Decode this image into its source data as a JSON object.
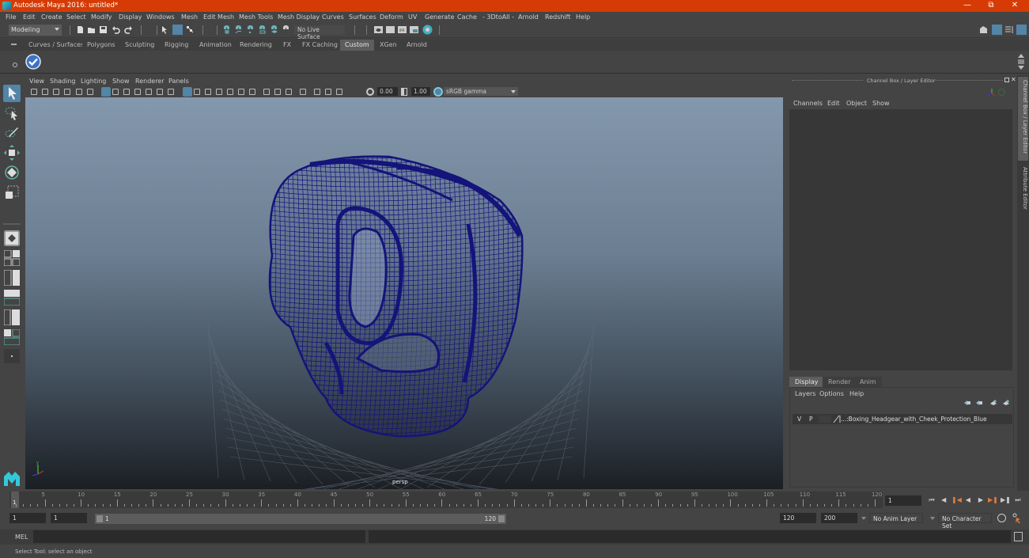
{
  "window": {
    "title": "Autodesk Maya 2016: untitled*",
    "controls": [
      "minimize",
      "restore",
      "close"
    ]
  },
  "menubar": {
    "items": [
      "File",
      "Edit",
      "Create",
      "Select",
      "Modify",
      "Display",
      "Windows",
      "Mesh",
      "Edit Mesh",
      "Mesh Tools",
      "Mesh Display",
      "Curves",
      "Surfaces",
      "Deform",
      "UV",
      "Generate",
      "Cache",
      "- 3DtoAll -",
      "Arnold",
      "Redshift",
      "Help"
    ]
  },
  "statusline": {
    "mode": "Modeling",
    "live_surface": "No Live Surface"
  },
  "shelf": {
    "tabs": [
      "Curves / Surfaces",
      "Polygons",
      "Sculpting",
      "Rigging",
      "Animation",
      "Rendering",
      "FX",
      "FX Caching",
      "Custom",
      "XGen",
      "Arnold"
    ],
    "active_tab": "Custom"
  },
  "viewport": {
    "menu": [
      "View",
      "Shading",
      "Lighting",
      "Show",
      "Renderer",
      "Panels"
    ],
    "exposure": "0.00",
    "gamma": "1.00",
    "color_space": "sRGB gamma",
    "camera": "persp",
    "wire_color": "#14147a"
  },
  "channel_box": {
    "title": "Channel Box / Layer Editor",
    "menu": [
      "Channels",
      "Edit",
      "Object",
      "Show"
    ]
  },
  "layer_editor": {
    "tabs": [
      "Display",
      "Render",
      "Anim"
    ],
    "active_tab": "Display",
    "menu": [
      "Layers",
      "Options",
      "Help"
    ],
    "layers": [
      {
        "visible": "V",
        "playback": "P",
        "name": "...:Boxing_Headgear_with_Cheek_Protection_Blue"
      }
    ]
  },
  "side_tabs": [
    "Channel Box / Layer Editor",
    "Attribute Editor"
  ],
  "timeline": {
    "ticks": [
      5,
      10,
      15,
      20,
      25,
      30,
      35,
      40,
      45,
      50,
      55,
      60,
      65,
      70,
      75,
      80,
      85,
      90,
      95,
      100,
      105,
      110,
      115,
      120
    ],
    "current_frame": "1",
    "current_frame_field": "1"
  },
  "range": {
    "start": "1",
    "playback_start": "1",
    "range_start_label": "1",
    "range_end_label": "120",
    "playback_end": "120",
    "end": "200",
    "anim_layer": "No Anim Layer",
    "character_set": "No Character Set"
  },
  "command_line": {
    "language": "MEL"
  },
  "help_line": {
    "text": "Select Tool: select an object"
  },
  "colors": {
    "title_bar": "#d63b05",
    "accent": "#5285a6",
    "panel": "#444444"
  }
}
